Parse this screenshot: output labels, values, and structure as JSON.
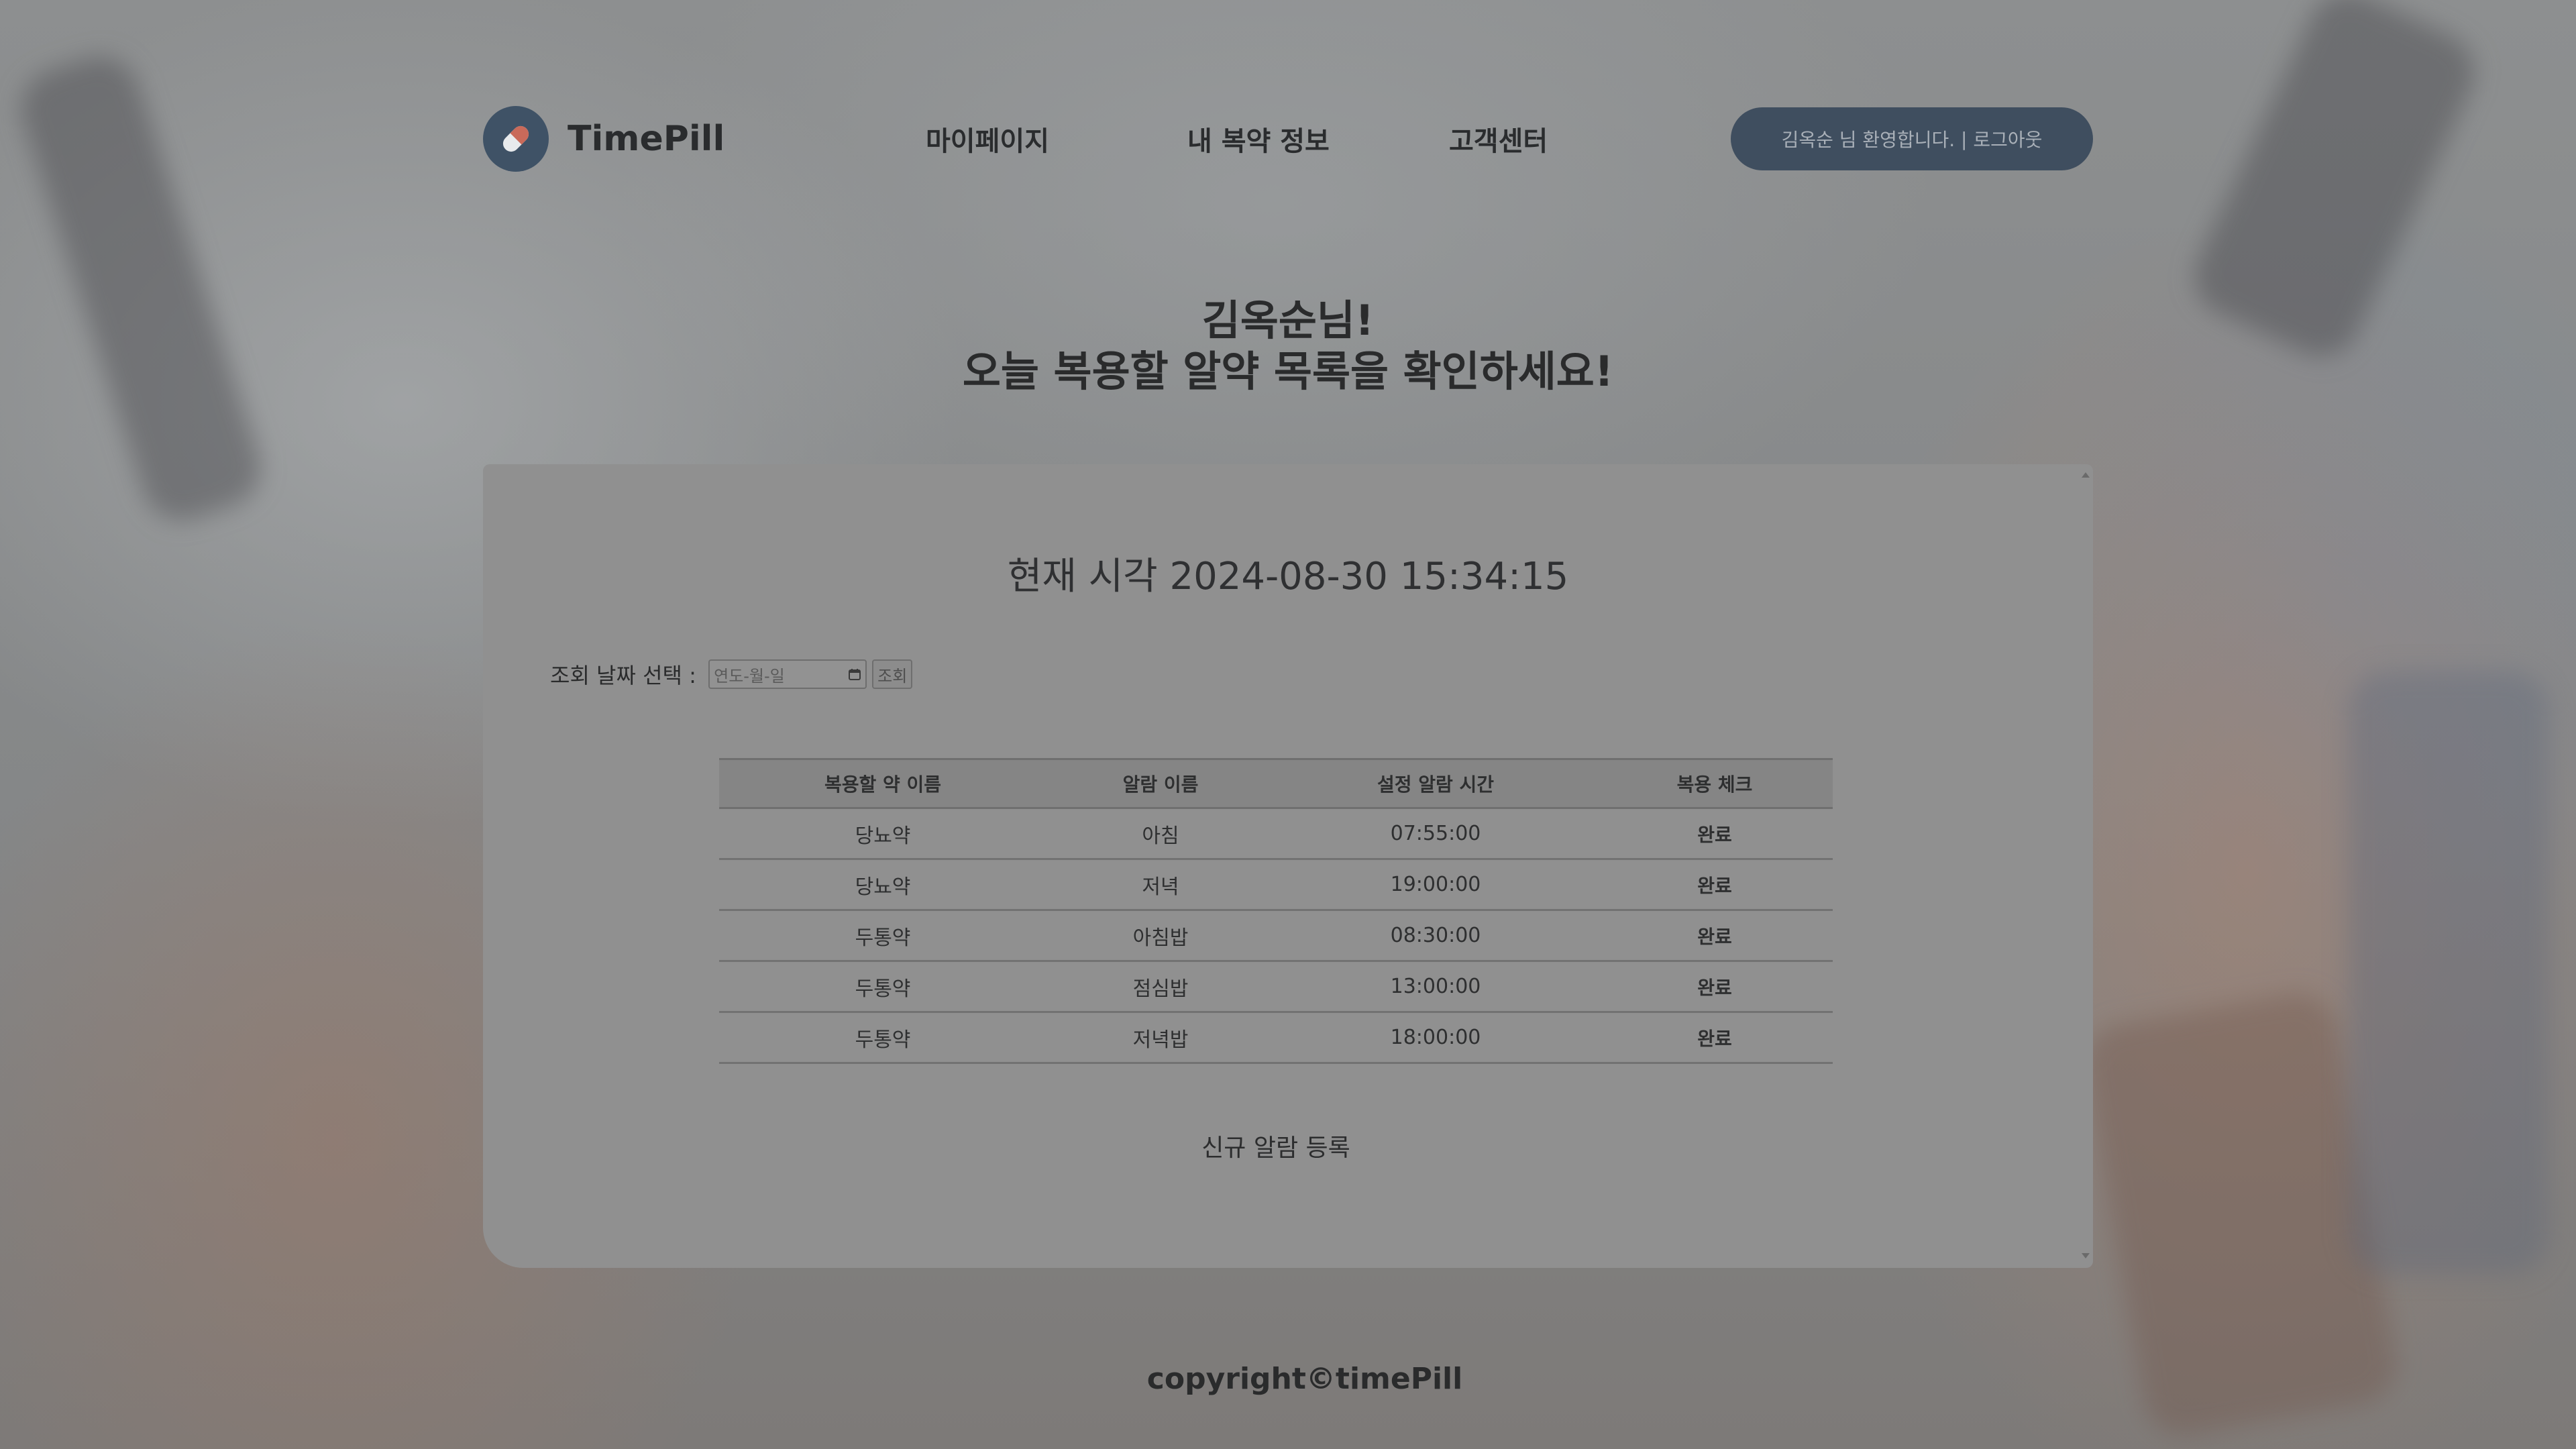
{
  "brand": {
    "name": "TimePill",
    "logo_icon": "pill-capsule-icon",
    "logo_color": "#3f5266"
  },
  "nav": {
    "items": [
      {
        "label": "마이페이지"
      },
      {
        "label": "내 복약 정보"
      },
      {
        "label": "고객센터"
      }
    ]
  },
  "user_bar": {
    "welcome": "김옥순 님 환영합니다.",
    "separator": " | ",
    "logout": "로그아웃"
  },
  "hero": {
    "line1": "김옥순님!",
    "line2": "오늘 복용할 알약 목록을 확인하세요!"
  },
  "card": {
    "clock": "현재 시각 2024-08-30 15:34:15",
    "date_filter": {
      "label": "조회 날짜 선택 : ",
      "placeholder": "연도-월-일",
      "button": "조회",
      "icon": "calendar-icon"
    },
    "table": {
      "headers": [
        "복용할 약 이름",
        "알람 이름",
        "설정 알람 시간",
        "복용 체크"
      ],
      "rows": [
        {
          "drug": "당뇨약",
          "alarm": "아침",
          "time": "07:55:00",
          "check": "완료"
        },
        {
          "drug": "당뇨약",
          "alarm": "저녁",
          "time": "19:00:00",
          "check": "완료"
        },
        {
          "drug": "두통약",
          "alarm": "아침밥",
          "time": "08:30:00",
          "check": "완료"
        },
        {
          "drug": "두통약",
          "alarm": "점심밥",
          "time": "13:00:00",
          "check": "완료"
        },
        {
          "drug": "두통약",
          "alarm": "저녁밥",
          "time": "18:00:00",
          "check": "완료"
        }
      ]
    },
    "new_alarm": "신규 알람 등록"
  },
  "footer": {
    "copyright": "copyright©timePill"
  },
  "colors": {
    "welcome_button": "#3f4e5f",
    "card_background": "#909090"
  }
}
